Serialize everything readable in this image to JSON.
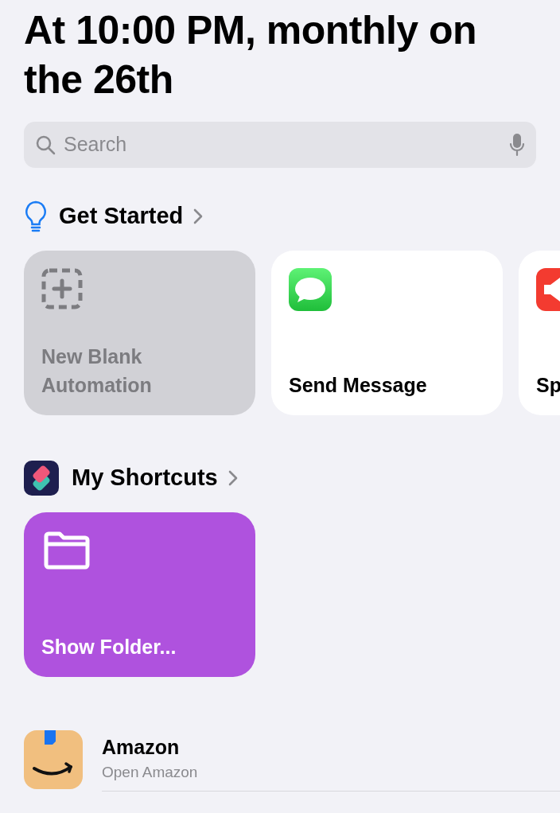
{
  "title": "At 10:00 PM, monthly on the 26th",
  "search": {
    "placeholder": "Search"
  },
  "get_started": {
    "heading": "Get Started",
    "cards": [
      {
        "kind": "blank",
        "label": "New Blank Automation"
      },
      {
        "kind": "message",
        "label": "Send Message"
      },
      {
        "kind": "speaker",
        "label": "Sp"
      }
    ]
  },
  "my_shortcuts": {
    "heading": "My Shortcuts",
    "cards": [
      {
        "kind": "folder",
        "label": "Show Folder..."
      }
    ]
  },
  "apps": [
    {
      "name": "Amazon",
      "subtitle": "Open Amazon"
    }
  ]
}
